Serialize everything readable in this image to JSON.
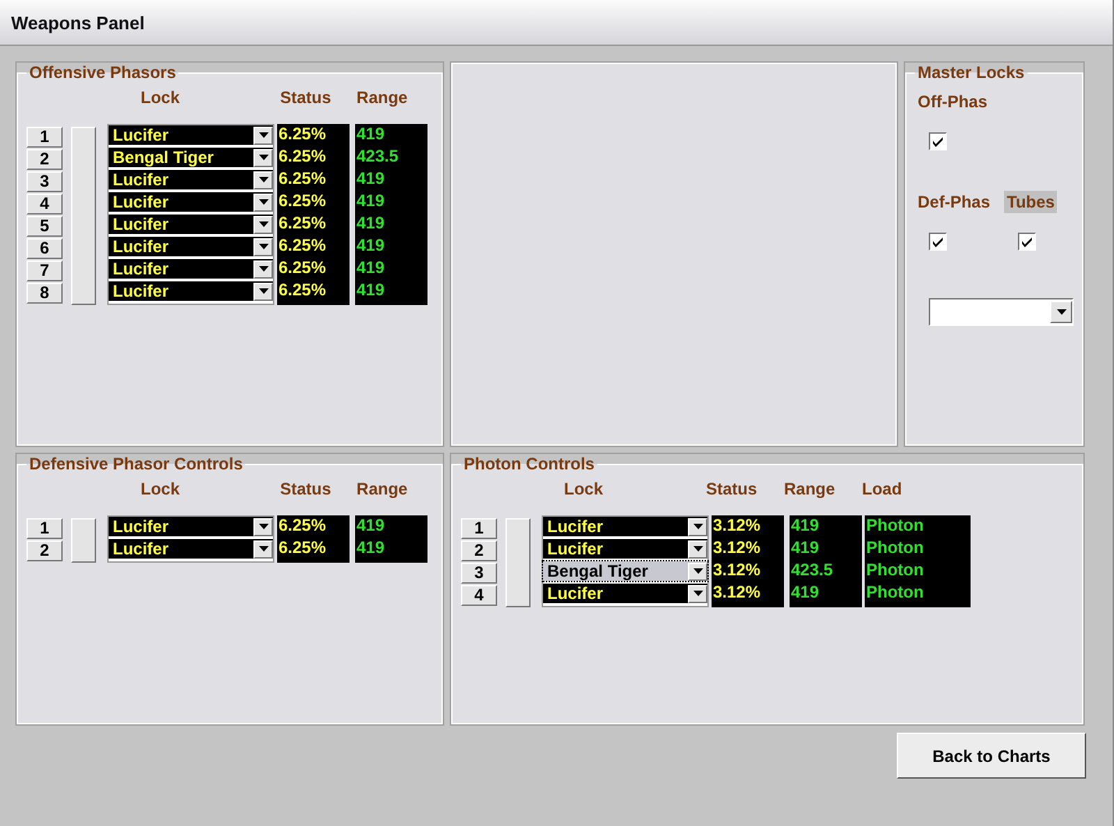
{
  "window": {
    "title": "Weapons Panel"
  },
  "offensive_phasors": {
    "title": "Offensive Phasors",
    "columns": [
      "Lock",
      "Status",
      "Range"
    ],
    "rows": [
      {
        "number": "1",
        "lock": "Lucifer",
        "status": "6.25%",
        "range": "419",
        "focused": false
      },
      {
        "number": "2",
        "lock": "Bengal Tiger",
        "status": "6.25%",
        "range": "423.5",
        "focused": false
      },
      {
        "number": "3",
        "lock": "Lucifer",
        "status": "6.25%",
        "range": "419",
        "focused": false
      },
      {
        "number": "4",
        "lock": "Lucifer",
        "status": "6.25%",
        "range": "419",
        "focused": false
      },
      {
        "number": "5",
        "lock": "Lucifer",
        "status": "6.25%",
        "range": "419",
        "focused": false
      },
      {
        "number": "6",
        "lock": "Lucifer",
        "status": "6.25%",
        "range": "419",
        "focused": false
      },
      {
        "number": "7",
        "lock": "Lucifer",
        "status": "6.25%",
        "range": "419",
        "focused": false
      },
      {
        "number": "8",
        "lock": "Lucifer",
        "status": "6.25%",
        "range": "419",
        "focused": false
      }
    ]
  },
  "master_locks": {
    "title": "Master Locks",
    "locks": [
      {
        "label": "Off-Phas",
        "checked": true,
        "highlighted": false
      },
      {
        "label": "Def-Phas",
        "checked": true,
        "highlighted": false
      },
      {
        "label": "Tubes",
        "checked": true,
        "highlighted": true
      }
    ]
  },
  "defensive_phasors": {
    "title": "Defensive Phasor Controls",
    "columns": [
      "Lock",
      "Status",
      "Range"
    ],
    "rows": [
      {
        "number": "1",
        "lock": "Lucifer",
        "status": "6.25%",
        "range": "419",
        "focused": false
      },
      {
        "number": "2",
        "lock": "Lucifer",
        "status": "6.25%",
        "range": "419",
        "focused": false
      }
    ]
  },
  "photon_controls": {
    "title": "Photon Controls",
    "columns": [
      "Lock",
      "Status",
      "Range",
      "Load"
    ],
    "rows": [
      {
        "number": "1",
        "lock": "Lucifer",
        "status": "3.12%",
        "range": "419",
        "load": "Photon",
        "focused": false
      },
      {
        "number": "2",
        "lock": "Lucifer",
        "status": "3.12%",
        "range": "419",
        "load": "Photon",
        "focused": false
      },
      {
        "number": "3",
        "lock": "Bengal Tiger",
        "status": "3.12%",
        "range": "423.5",
        "load": "Photon",
        "focused": true
      },
      {
        "number": "4",
        "lock": "Lucifer",
        "status": "3.12%",
        "range": "419",
        "load": "Photon",
        "focused": false
      }
    ]
  },
  "back_button": "Back to Charts"
}
